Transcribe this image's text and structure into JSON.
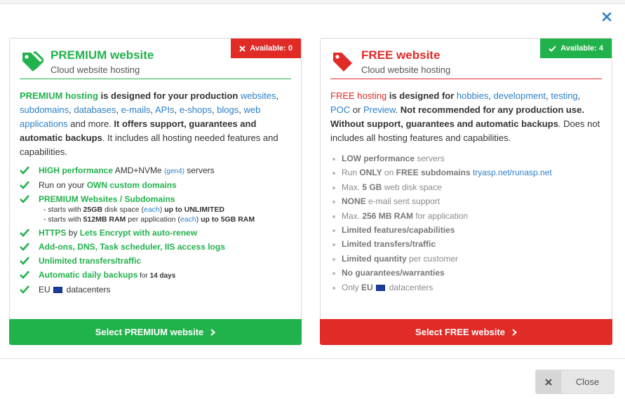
{
  "dialog": {
    "close_label": "Close"
  },
  "premium": {
    "title": "PREMIUM website",
    "subtitle": "Cloud website hosting",
    "badge": "Available: 0",
    "desc": {
      "p1_hl": "PREMIUM hosting",
      "p1_a": " is designed for your production ",
      "l_websites": "websites",
      "c1": ", ",
      "l_subdomains": "subdomains",
      "c2": ", ",
      "l_databases": "databases",
      "c3": ", ",
      "l_emails": "e-mails",
      "c4": ", ",
      "l_apis": "APIs",
      "c5": ", ",
      "l_eshops": "e-shops",
      "c6": ", ",
      "l_blogs": "blogs",
      "c7": ", ",
      "l_webapps": "web applications",
      "p1_b": " and more. ",
      "p1_bold": "It offers support, guarantees and automatic backups",
      "p1_c": ". It includes all hosting needed features and capabilities."
    },
    "features": {
      "f1_hl": "HIGH performance",
      "f1_a": " AMD+NVMe ",
      "f1_link": "(gen4)",
      "f1_b": " servers",
      "f2_a": "Run on your ",
      "f2_hl": "OWN custom domains",
      "f3_hl": "PREMIUM Websites / Subdomains",
      "f3_s1_a": "- starts with ",
      "f3_s1_b": "25GB",
      "f3_s1_c": " disk space (",
      "f3_s1_link": "each",
      "f3_s1_d": ") ",
      "f3_s1_e": "up to UNLIMITED",
      "f3_s2_a": "- starts with ",
      "f3_s2_b": "512MB RAM",
      "f3_s2_c": " per application (",
      "f3_s2_link": "each",
      "f3_s2_d": ") ",
      "f3_s2_e": "up to 5GB RAM",
      "f4_hl": "HTTPS",
      "f4_a": " by ",
      "f4_hl2": "Lets Encrypt with auto-renew",
      "f5": "Add-ons, DNS, Task scheduler, IIS access logs",
      "f6": "Unlimited transfers/traffic",
      "f7_hl": "Automatic daily backups",
      "f7_a": " for ",
      "f7_b": "14 days",
      "f8_a": "EU",
      "f8_b": "datacenters"
    },
    "button": "Select PREMIUM website"
  },
  "free": {
    "title": "FREE website",
    "subtitle": "Cloud website hosting",
    "badge": "Available: 4",
    "desc": {
      "hl": "FREE hosting",
      "a": " is designed for ",
      "l_hobbies": "hobbies",
      "c1": ", ",
      "l_dev": "development",
      "c2": ", ",
      "l_testing": "testing",
      "c3": ", ",
      "l_poc": "POC",
      "b": " or ",
      "l_preview": "Preview",
      "c": ". ",
      "bold1": "Not recommended for any production use. Without support, guarantees and automatic backups",
      "d": ". Does not includes all hosting features and capabilities."
    },
    "list": {
      "i1_b": "LOW performance",
      "i1_a": " servers",
      "i2_a": "Run ",
      "i2_b": "ONLY",
      "i2_c": " on ",
      "i2_d": "FREE subdomains",
      "i2_e": " ",
      "i2_l1": "tryasp.net",
      "i2_sl": "/",
      "i2_l2": "runasp.net",
      "i3_a": "Max. ",
      "i3_b": "5 GB",
      "i3_c": " web disk space",
      "i4_b": "NONE",
      "i4_a": " e-mail sent support",
      "i5_a": "Max. ",
      "i5_b": "256 MB RAM",
      "i5_c": " for application",
      "i6": "Limited features/capabilities",
      "i7": "Limited transfers/traffic",
      "i8_b": "Limited quantity",
      "i8_a": " per customer",
      "i9": "No guarantees/warranties",
      "i10_a": "Only ",
      "i10_b": "EU",
      "i10_c": "datacenters"
    },
    "button": "Select FREE website"
  },
  "colors": {
    "green": "#22b24c",
    "red": "#e02b27",
    "link": "#2a7fc8"
  },
  "icons": [
    "close-icon",
    "tags-icon",
    "tag-icon",
    "check-icon",
    "x-icon",
    "chevron-right-icon",
    "eu-flag-icon"
  ]
}
